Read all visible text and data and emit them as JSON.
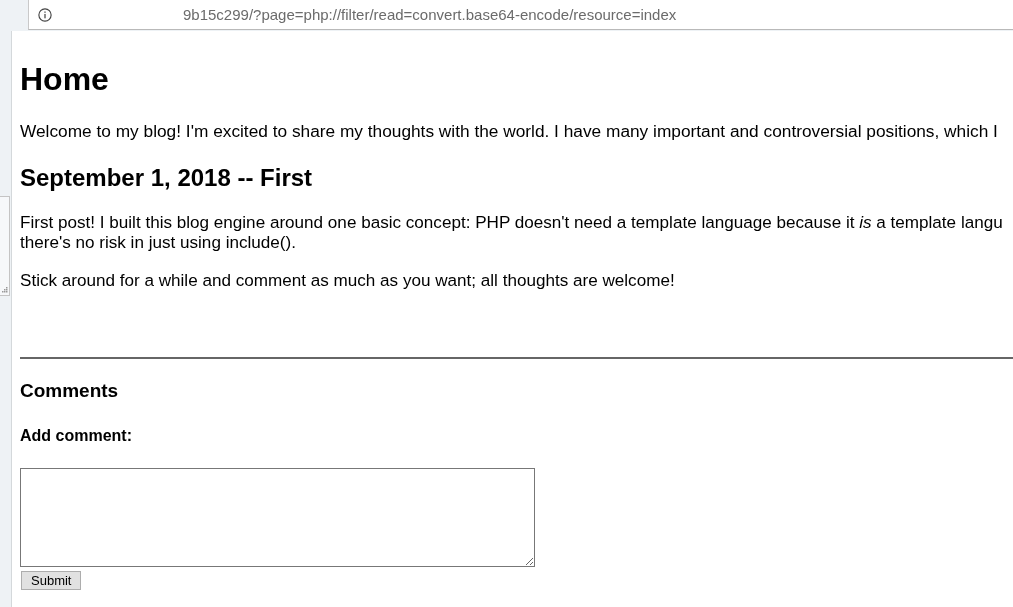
{
  "address_bar": {
    "url": "9b15c299/?page=php://filter/read=convert.base64-encode/resource=index"
  },
  "page": {
    "title": "Home",
    "intro": "Welcome to my blog! I'm excited to share my thoughts with the world. I have many important and controversial positions, which I",
    "posts": [
      {
        "heading": "September 1, 2018 -- First",
        "paragraphs": [
          {
            "lines": [
              "First post! I built this blog engine around one basic concept: PHP doesn't need a template language because it *is* a template langu",
              "there's no risk in just using include()."
            ]
          },
          {
            "lines": [
              "Stick around for a while and comment as much as you want; all thoughts are welcome!"
            ]
          }
        ]
      }
    ],
    "comments": {
      "heading": "Comments",
      "add_label": "Add comment:",
      "submit": "Submit"
    }
  }
}
